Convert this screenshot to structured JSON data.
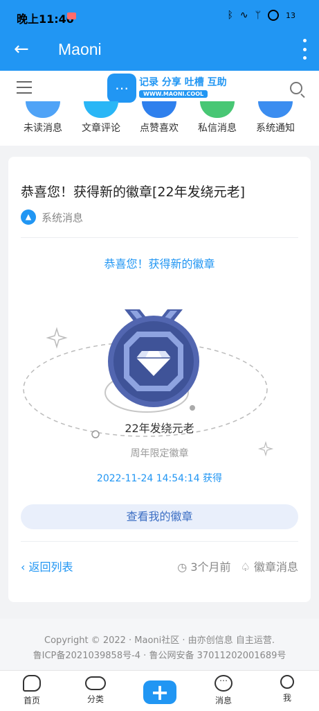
{
  "status": {
    "time": "晚上11:40",
    "battery": "13"
  },
  "appbar": {
    "title": "Maoni"
  },
  "logo": {
    "slogan": "记录 分享 吐槽 互助",
    "url": "WWW.MAONI.COOL"
  },
  "categories": [
    {
      "label": "未读消息",
      "color": "#4fa3f7"
    },
    {
      "label": "文章评论",
      "color": "#29b6f6"
    },
    {
      "label": "点赞喜欢",
      "color": "#2f80ed"
    },
    {
      "label": "私信消息",
      "color": "#48c774"
    },
    {
      "label": "系统通知",
      "color": "#3b8df0"
    }
  ],
  "message": {
    "title": "恭喜您！获得新的徽章[22年发绕元老]",
    "source": "系统消息",
    "congrats": "恭喜您！获得新的徽章",
    "badge_name": "22年发绕元老",
    "badge_desc": "周年限定徽章",
    "obtained": "2022-11-24 14:54:14 获得",
    "view_button": "查看我的徽章",
    "back_link": "返回列表",
    "time_ago": "3个月前",
    "category": "徽章消息"
  },
  "footer": {
    "copyright": "Copyright © 2022 · Maoni社区 · 由亦创信息 自主运营.",
    "icp": "鲁ICP备2021039858号-4 · 鲁公网安备 37011202001689号"
  },
  "tabs": [
    {
      "label": "首页"
    },
    {
      "label": "分类"
    },
    {
      "label": "消息"
    },
    {
      "label": "我"
    }
  ],
  "colors": {
    "primary": "#2196f3",
    "badge": "#4a5fa8"
  }
}
